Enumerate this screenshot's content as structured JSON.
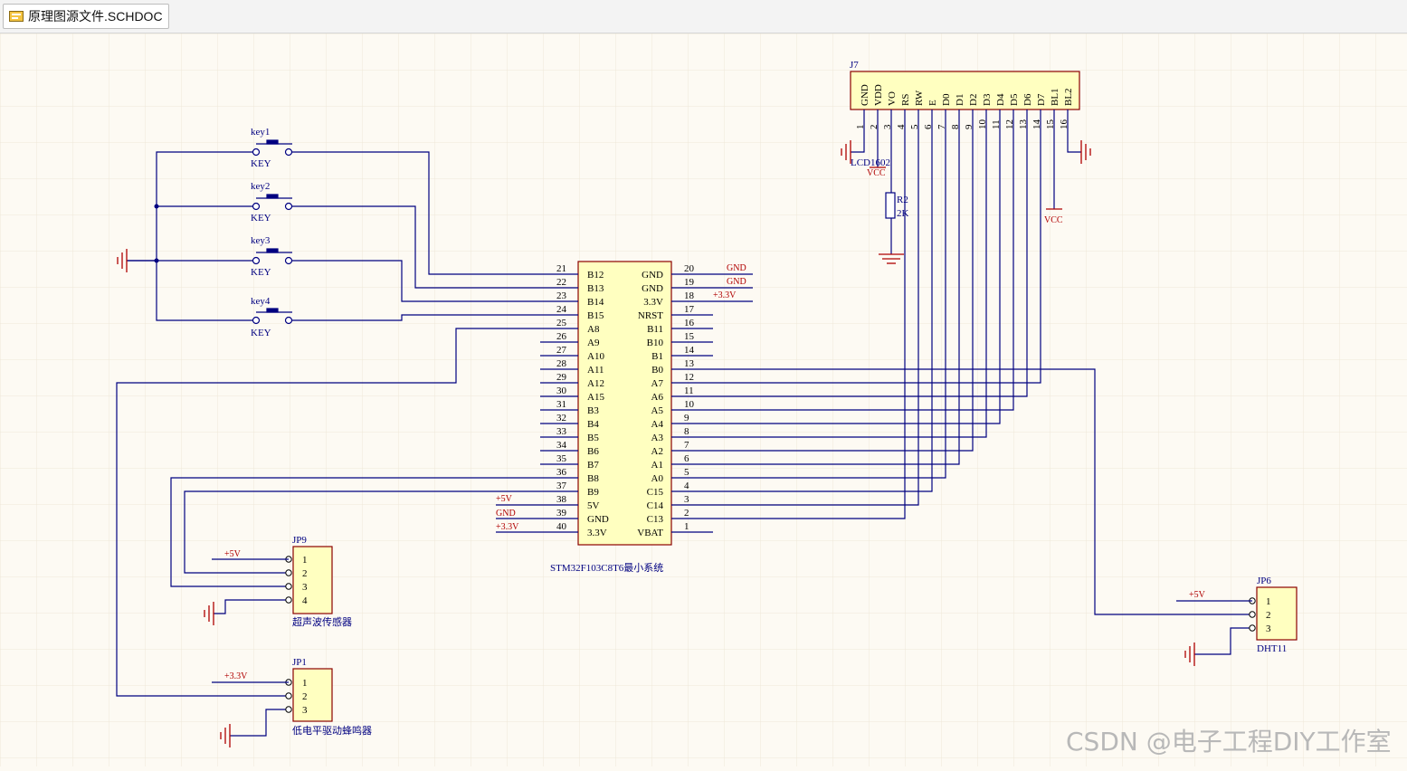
{
  "tab": {
    "title": "原理图源文件.SCHDOC",
    "icon": "schematic-doc-icon"
  },
  "colors": {
    "wire": "#000080",
    "body_fill": "#ffffc0",
    "body_stroke": "#8b0000",
    "netlabel": "#b00000",
    "power": "#b00000",
    "background": "#fdfaf3",
    "grid": "#efe8d8"
  },
  "mcu": {
    "comment": "STM32F103C8T6最小系统",
    "left_pins": [
      {
        "num": "21",
        "name": "B12"
      },
      {
        "num": "22",
        "name": "B13"
      },
      {
        "num": "23",
        "name": "B14"
      },
      {
        "num": "24",
        "name": "B15"
      },
      {
        "num": "25",
        "name": "A8"
      },
      {
        "num": "26",
        "name": "A9"
      },
      {
        "num": "27",
        "name": "A10"
      },
      {
        "num": "28",
        "name": "A11"
      },
      {
        "num": "29",
        "name": "A12"
      },
      {
        "num": "30",
        "name": "A15"
      },
      {
        "num": "31",
        "name": "B3"
      },
      {
        "num": "32",
        "name": "B4"
      },
      {
        "num": "33",
        "name": "B5"
      },
      {
        "num": "34",
        "name": "B6"
      },
      {
        "num": "35",
        "name": "B7"
      },
      {
        "num": "36",
        "name": "B8"
      },
      {
        "num": "37",
        "name": "B9"
      },
      {
        "num": "38",
        "name": "5V"
      },
      {
        "num": "39",
        "name": "GND"
      },
      {
        "num": "40",
        "name": "3.3V"
      }
    ],
    "right_pins": [
      {
        "num": "20",
        "name": "GND"
      },
      {
        "num": "19",
        "name": "GND"
      },
      {
        "num": "18",
        "name": "3.3V"
      },
      {
        "num": "17",
        "name": "NRST"
      },
      {
        "num": "16",
        "name": "B11"
      },
      {
        "num": "15",
        "name": "B10"
      },
      {
        "num": "14",
        "name": "B1"
      },
      {
        "num": "13",
        "name": "B0"
      },
      {
        "num": "12",
        "name": "A7"
      },
      {
        "num": "11",
        "name": "A6"
      },
      {
        "num": "10",
        "name": "A5"
      },
      {
        "num": "9",
        "name": "A4"
      },
      {
        "num": "8",
        "name": "A3"
      },
      {
        "num": "7",
        "name": "A2"
      },
      {
        "num": "6",
        "name": "A1"
      },
      {
        "num": "5",
        "name": "A0"
      },
      {
        "num": "4",
        "name": "C15"
      },
      {
        "num": "3",
        "name": "C14"
      },
      {
        "num": "2",
        "name": "C13"
      },
      {
        "num": "1",
        "name": "VBAT"
      }
    ],
    "netlabels": {
      "p20": "GND",
      "p19": "GND",
      "p18": "+3.3V",
      "p38": "+5V",
      "p39": "GND",
      "p40": "+3.3V"
    }
  },
  "keys": [
    {
      "designator": "key1",
      "comment": "KEY"
    },
    {
      "designator": "key2",
      "comment": "KEY"
    },
    {
      "designator": "key3",
      "comment": "KEY"
    },
    {
      "designator": "key4",
      "comment": "KEY"
    }
  ],
  "lcd": {
    "designator": "J7",
    "comment": "LCD1602",
    "pins": [
      {
        "num": "1",
        "name": "GND"
      },
      {
        "num": "2",
        "name": "VDD"
      },
      {
        "num": "3",
        "name": "VO"
      },
      {
        "num": "4",
        "name": "RS"
      },
      {
        "num": "5",
        "name": "RW"
      },
      {
        "num": "6",
        "name": "E"
      },
      {
        "num": "7",
        "name": "D0"
      },
      {
        "num": "8",
        "name": "D1"
      },
      {
        "num": "9",
        "name": "D2"
      },
      {
        "num": "10",
        "name": "D3"
      },
      {
        "num": "11",
        "name": "D4"
      },
      {
        "num": "12",
        "name": "D5"
      },
      {
        "num": "13",
        "name": "D6"
      },
      {
        "num": "14",
        "name": "D7"
      },
      {
        "num": "15",
        "name": "BL1"
      },
      {
        "num": "16",
        "name": "BL2"
      }
    ],
    "vcc1": "VCC",
    "vcc2": "VCC"
  },
  "resistor": {
    "designator": "R2",
    "value": "2K"
  },
  "jp9": {
    "designator": "JP9",
    "comment": "超声波传感器",
    "pins": [
      "1",
      "2",
      "3",
      "4"
    ],
    "netlabel": "+5V"
  },
  "jp1": {
    "designator": "JP1",
    "comment": "低电平驱动蜂鸣器",
    "pins": [
      "1",
      "2",
      "3"
    ],
    "netlabel": "+3.3V"
  },
  "jp6": {
    "designator": "JP6",
    "comment": "DHT11",
    "pins": [
      "1",
      "2",
      "3"
    ],
    "netlabel": "+5V"
  },
  "watermark": "CSDN @电子工程DIY工作室"
}
